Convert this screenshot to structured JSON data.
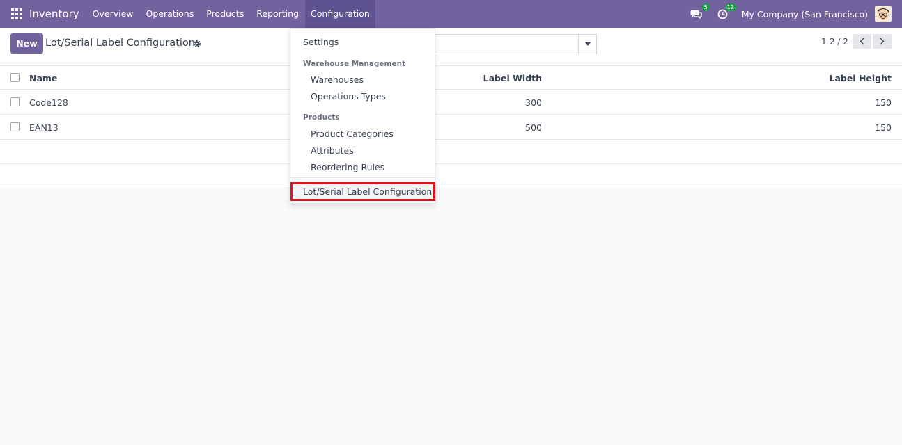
{
  "navbar": {
    "app_title": "Inventory",
    "menu": [
      {
        "label": "Overview"
      },
      {
        "label": "Operations"
      },
      {
        "label": "Products"
      },
      {
        "label": "Reporting"
      },
      {
        "label": "Configuration",
        "active": true
      }
    ],
    "messages_badge": "5",
    "activities_badge": "12",
    "company": "My Company (San Francisco)"
  },
  "control_panel": {
    "new_label": "New",
    "title": "Lot/Serial Label Configuration",
    "search_placeholder": "",
    "pager": "1-2 / 2"
  },
  "table": {
    "columns": [
      "Name",
      "Label Width",
      "Label Height"
    ],
    "rows": [
      {
        "name": "Code128",
        "width": "300",
        "height": "150"
      },
      {
        "name": "EAN13",
        "width": "500",
        "height": "150"
      }
    ]
  },
  "dropdown": {
    "settings": "Settings",
    "warehouse_header": "Warehouse Management",
    "warehouses": "Warehouses",
    "operation_types": "Operations Types",
    "products_header": "Products",
    "product_categories": "Product Categories",
    "attributes": "Attributes",
    "reordering_rules": "Reordering Rules",
    "lot_serial": "Lot/Serial Label Configuration"
  },
  "colors": {
    "brand": "#71639e",
    "highlight": "#e1141e",
    "badge": "#1e9e4a"
  }
}
